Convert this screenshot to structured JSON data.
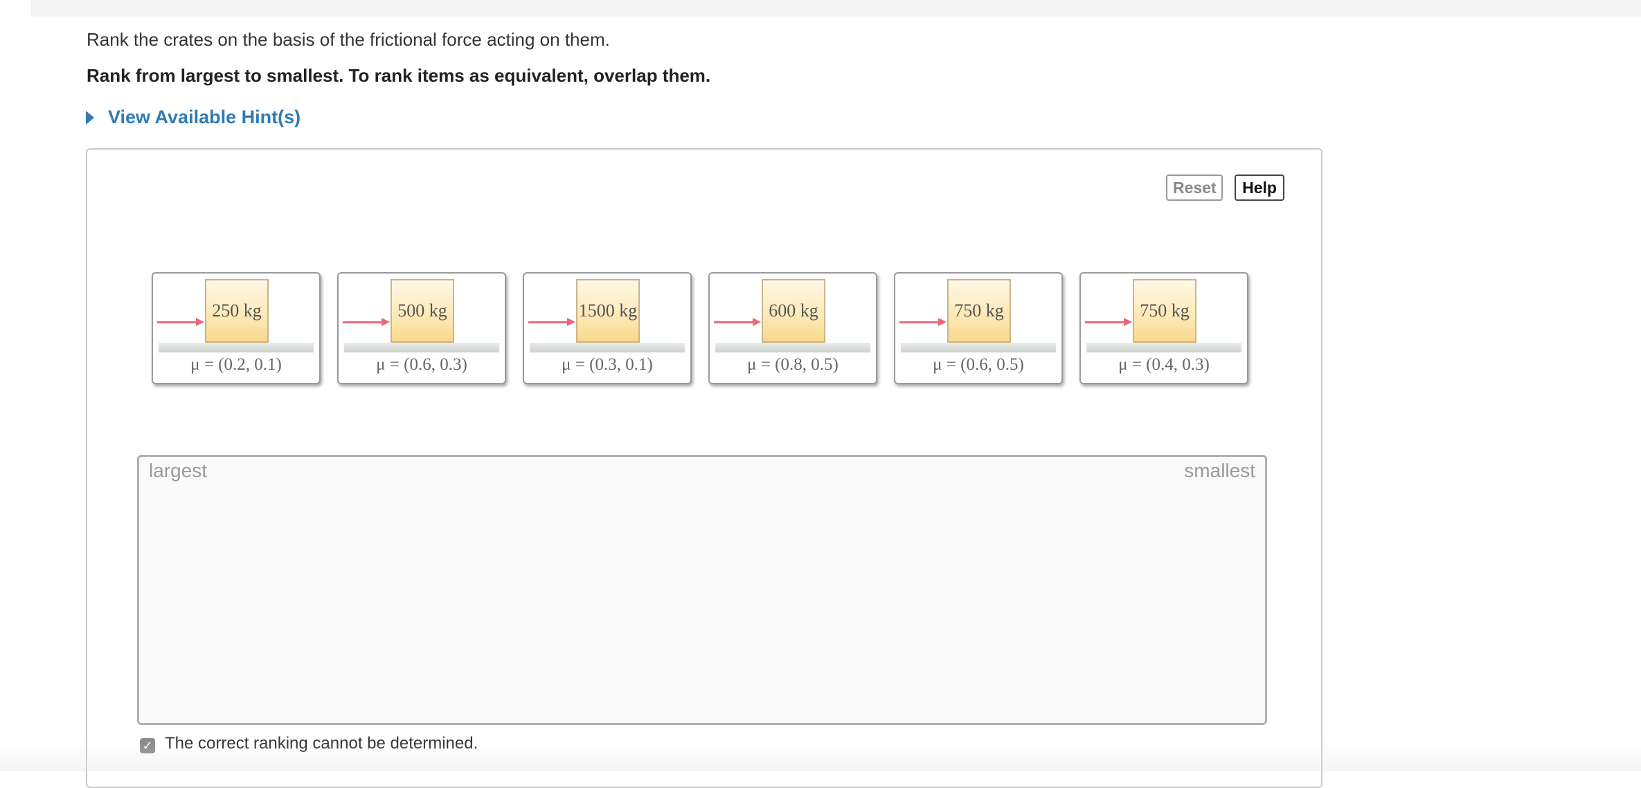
{
  "question": {
    "prompt": "Rank the crates on the basis of the frictional force acting on them.",
    "instruction": "Rank from largest to smallest. To rank items as equivalent, overlap them.",
    "hint_label": "View Available Hint(s)"
  },
  "toolbar": {
    "reset_label": "Reset",
    "help_label": "Help"
  },
  "crates": [
    {
      "mass": "250 kg",
      "mu": "μ = (0.2, 0.1)"
    },
    {
      "mass": "500 kg",
      "mu": "μ = (0.6, 0.3)"
    },
    {
      "mass": "1500 kg",
      "mu": "μ = (0.3, 0.1)"
    },
    {
      "mass": "600 kg",
      "mu": "μ = (0.8, 0.5)"
    },
    {
      "mass": "750 kg",
      "mu": "μ = (0.6, 0.5)"
    },
    {
      "mass": "750 kg",
      "mu": "μ = (0.4, 0.3)"
    }
  ],
  "ranking": {
    "left_label": "largest",
    "right_label": "smallest"
  },
  "cannot_determine": {
    "label": "The correct ranking cannot be determined.",
    "checked": true
  },
  "colors": {
    "link": "#2f7bb3",
    "arrow": "#e9687b",
    "crate": "#fde8b5"
  },
  "icons": {
    "hint_toggle": "caret-right-icon",
    "checkbox": "checkmark-icon"
  }
}
